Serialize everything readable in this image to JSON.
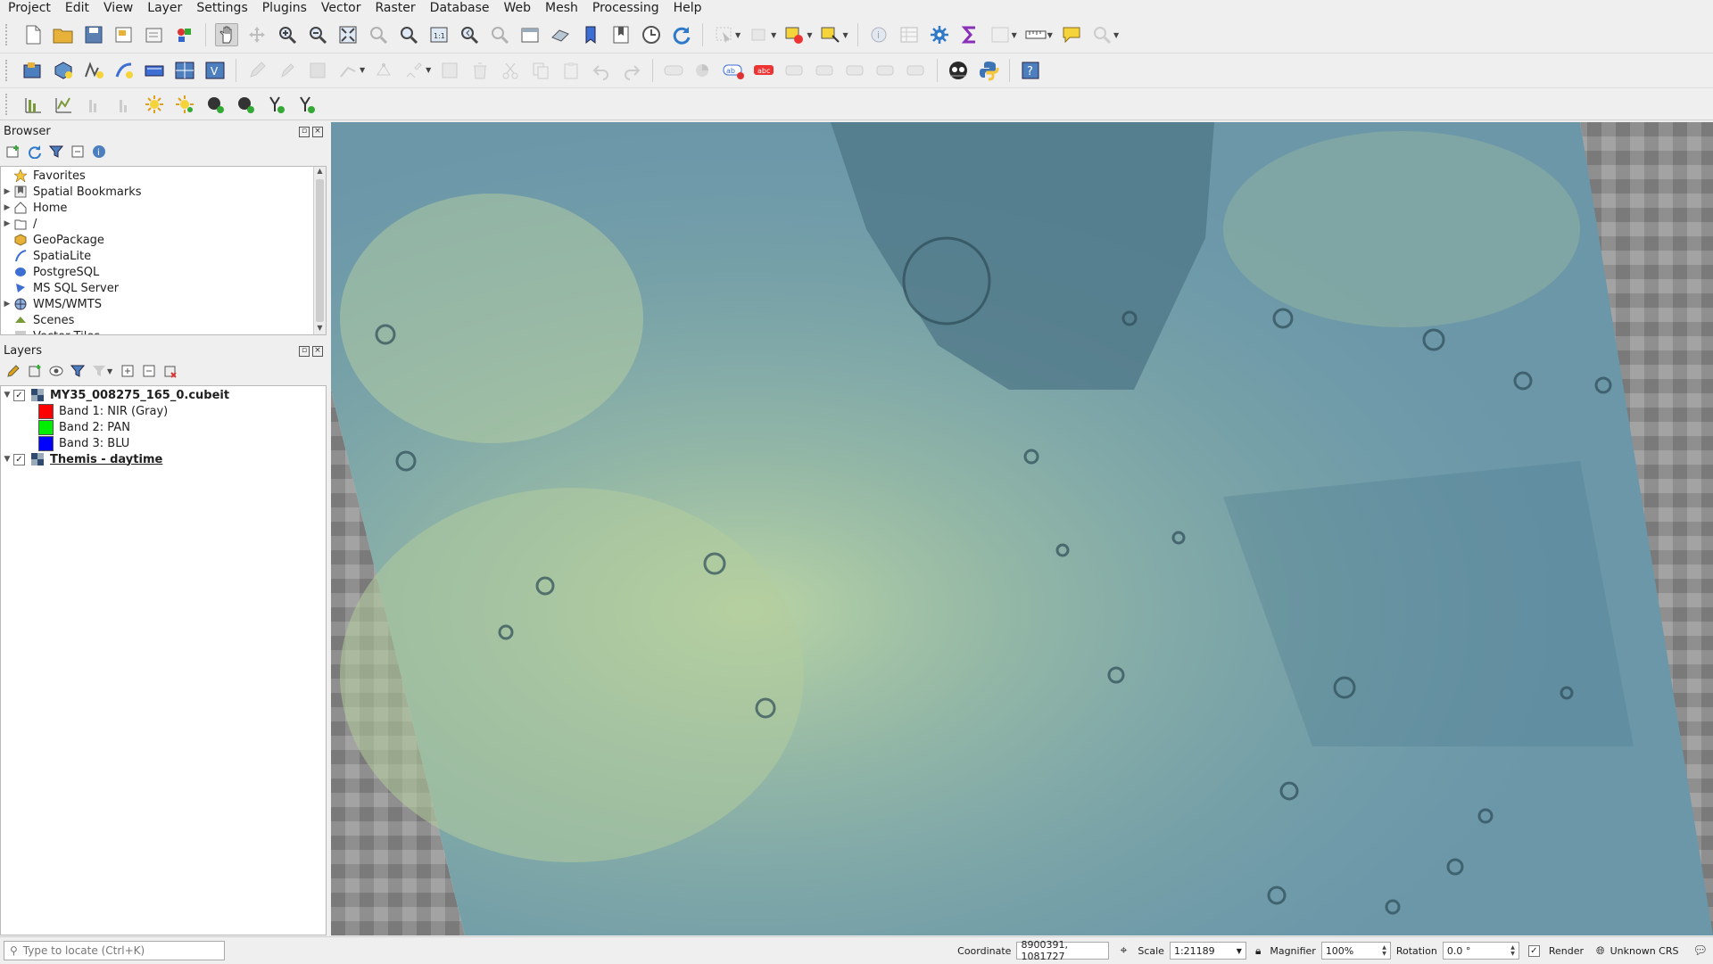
{
  "menu": [
    "Project",
    "Edit",
    "View",
    "Layer",
    "Settings",
    "Plugins",
    "Vector",
    "Raster",
    "Database",
    "Web",
    "Mesh",
    "Processing",
    "Help"
  ],
  "browser": {
    "title": "Browser",
    "items": [
      {
        "label": "Favorites",
        "icon": "star-icon",
        "expandable": false
      },
      {
        "label": "Spatial Bookmarks",
        "icon": "bookmark-icon",
        "expandable": true
      },
      {
        "label": "Home",
        "icon": "home-folder-icon",
        "expandable": true
      },
      {
        "label": "/",
        "icon": "folder-icon",
        "expandable": true
      },
      {
        "label": "GeoPackage",
        "icon": "geopackage-icon",
        "expandable": false
      },
      {
        "label": "SpatiaLite",
        "icon": "spatialite-icon",
        "expandable": false
      },
      {
        "label": "PostgreSQL",
        "icon": "postgresql-icon",
        "expandable": false
      },
      {
        "label": "MS SQL Server",
        "icon": "mssql-icon",
        "expandable": false
      },
      {
        "label": "WMS/WMTS",
        "icon": "globe-icon",
        "expandable": true
      },
      {
        "label": "Scenes",
        "icon": "scenes-icon",
        "expandable": false
      },
      {
        "label": "Vector Tiles",
        "icon": "vector-tiles-icon",
        "expandable": false
      }
    ]
  },
  "layers": {
    "title": "Layers",
    "items": [
      {
        "label": "MY35_008275_165_0.cubeit",
        "checked": true,
        "bold": true
      },
      {
        "label": "Band 1: NIR (Gray)",
        "color": "#ff0000"
      },
      {
        "label": "Band 2: PAN",
        "color": "#00ee00"
      },
      {
        "label": "Band 3: BLU",
        "color": "#0000ff"
      },
      {
        "label": "Themis - daytime",
        "checked": true,
        "bold": true,
        "underline": true
      }
    ]
  },
  "status": {
    "locator_placeholder": "Type to locate (Ctrl+K)",
    "coordinate_label": "Coordinate",
    "coordinate_value": "8900391, 1081727",
    "scale_label": "Scale",
    "scale_value": "1:21189",
    "magnifier_label": "Magnifier",
    "magnifier_value": "100%",
    "rotation_label": "Rotation",
    "rotation_value": "0.0 °",
    "render_label": "Render",
    "crs_label": "Unknown CRS"
  },
  "colors": {
    "accent": "#2f6fb3",
    "map_blue": "#5f8fa6",
    "map_green": "#a9c6a0"
  }
}
